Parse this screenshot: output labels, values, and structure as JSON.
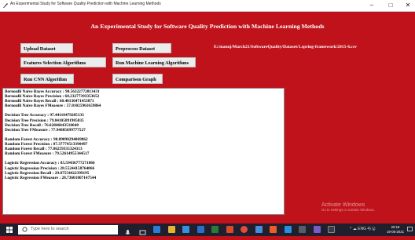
{
  "window": {
    "title": "An Experimental Study for Software Quality Prediction with Machine Learning Methods",
    "minimize_glyph": "–",
    "maximize_glyph": "□",
    "close_glyph": "✕"
  },
  "header": {
    "title": "An Experimental Study for Software Quality Prediction with Machine Learning Methods"
  },
  "buttons": {
    "upload": "Upload Dataset",
    "preprocess": "Preprocess Dataset",
    "feature_selection": "Features Selection Algorithms",
    "run_ml": "Run Machine Learning Algorithms",
    "run_cnn": "Run CNN Algorithm",
    "comparison": "Comparison Graph"
  },
  "dataset_path": "E:/manoj/March21/SoftwareQuality/Dataset/1.spring-framework/2015-6.csv",
  "output": {
    "lines": [
      "Bernoulli Naive Bayes Accuracy : 90.56322772813431",
      "Bernoulli Naive Bayes Precision : 68.23277393353652",
      "Bernoulli Naive Bayes Recall : 60.40136471453871",
      "Bernoulli Naive Bayes FMeasure : 57.01025961659864",
      "",
      "Decision Tree Accuracy : 97.44110479285133",
      "Decision Tree Precision : 79.84105891985035",
      "Decision Tree Recall : 76.82846043510048",
      "Decision Tree FMeasure : 77.94885699777527",
      "",
      "Random Forest Accuracy : 98.09098294069862",
      "Random Forest Precision : 87.37774513390497",
      "Random Forest Recall : 77.86259335324313",
      "Random Forest FMeasure : 79.52614955344517",
      "",
      "Logistic Regression Accuracy : 85.59436777271866",
      "Logistic Regression Precision : 28.55244158764066",
      "Logistic Regression Recall : 29.07554422399195",
      "Logistic Regression FMeasure : 28.73601807147544"
    ]
  },
  "watermark": {
    "title": "Activate Windows",
    "subtitle": "Go to Settings to activate Windows."
  },
  "taskbar": {
    "search_placeholder": "Type here to search",
    "tray_text": "^ ☁ ENG 4) 🖫",
    "time": "20:19",
    "date": "19-05-2021"
  },
  "colors": {
    "background": "#c0121a",
    "taskbar": "#1f1f2e"
  }
}
